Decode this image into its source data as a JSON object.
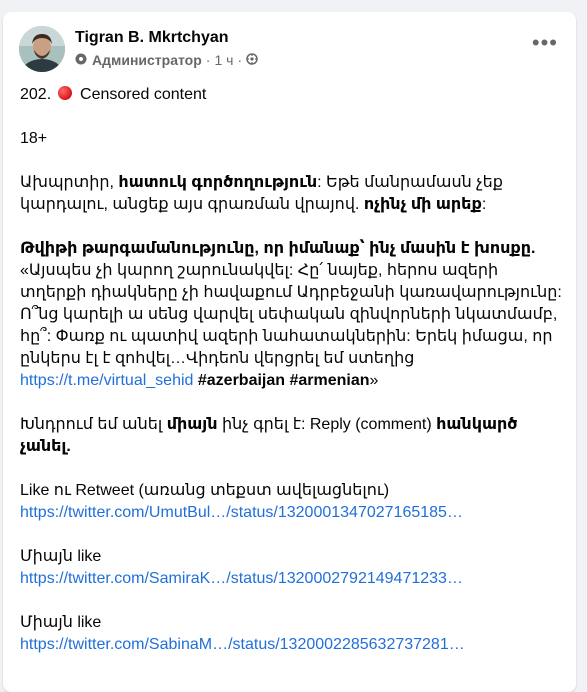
{
  "post": {
    "author": "Tigran B. Mkrtchyan",
    "role": "Администратор",
    "time": "1 ч",
    "options_icon": "more-horizontal-icon",
    "lines": {
      "l1_num": "202.",
      "l1_text": "Censored content",
      "l2": "18+",
      "p3_a": "Ախպրտիր, ",
      "p3_b": "հատուկ գործողություն",
      "p3_c": ": Եթե մանրամասն չեք կարդալու, անցեք այս գրառման վրայով. ",
      "p3_d": "ոչինչ մի արեք",
      "p3_e": ":",
      "p4_bold": "Թվիթի թարգամանությունը, որ իմանաք՝ ինչ մասին է խոսքը.",
      "p4_text": "«Այսպես չի կարող շարունակվել: Հը՛ նայեք, հերոս ազերի տղերքի դիակները չի հավաքում Ադրբեջանի կառավարությունը: Ո՞նց կարելի ա սենց վարվել սեփական զինվորների նկատմամբ, հը՞: Փառք ու պատիվ ազերի նահատակներին: Երեկ իմացա, որ ընկերս էլ է զոհվել…Վիդեոն վերցրել եմ ստեղից ",
      "p4_link": "https://t.me/virtual_sehid",
      "p4_tags": " #azerbaijan #armenian",
      "p4_end": "»",
      "p5_a": "Խնդրում եմ անել ",
      "p5_b": "միայն",
      "p5_c": " ինչ գրել է: Reply (comment) ",
      "p5_d": "հանկարծ չանել.",
      "p6_text": "Like ու Retweet (առանց տեքստ ավելացնելու)",
      "p6_link": "https://twitter.com/UmutBul…/status/1320001347027165185…",
      "p7_text": "Միայն like",
      "p7_link": "https://twitter.com/SamiraK…/status/1320002792149471233…",
      "p8_text": "Միայն like",
      "p8_link": "https://twitter.com/SabinaM…/status/1320002285632737281…"
    }
  }
}
